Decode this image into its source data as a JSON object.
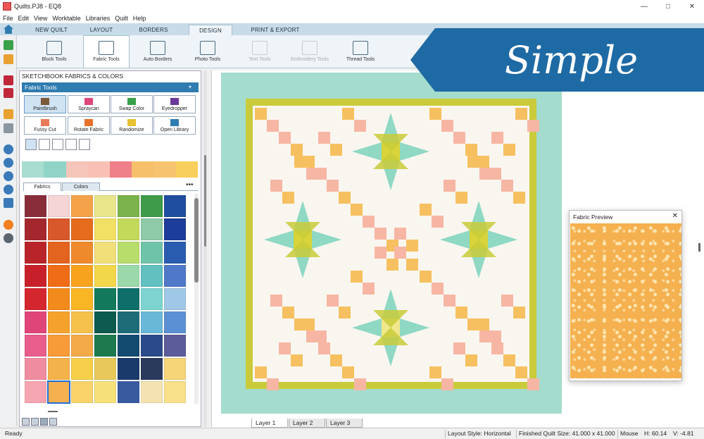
{
  "window": {
    "title": "Quilts.PJ8 - EQ8",
    "min": "—",
    "max": "□",
    "close": "✕"
  },
  "menu": [
    "File",
    "Edit",
    "View",
    "Worktable",
    "Libraries",
    "Quilt",
    "Help"
  ],
  "tabs": [
    "NEW QUILT",
    "LAYOUT",
    "BORDERS",
    "DESIGN",
    "PRINT & EXPORT"
  ],
  "active_tab": "DESIGN",
  "ribbon": [
    {
      "label": "Block Tools",
      "state": "normal"
    },
    {
      "label": "Fabric Tools",
      "state": "active"
    },
    {
      "label": "Auto Borders",
      "state": "normal"
    },
    {
      "label": "Photo Tools",
      "state": "normal"
    },
    {
      "label": "Text Tools",
      "state": "disabled"
    },
    {
      "label": "Embroidery Tools",
      "state": "disabled"
    },
    {
      "label": "Thread Tools",
      "state": "normal"
    }
  ],
  "banner": {
    "text": "Simple",
    "color": "#1e6aa5"
  },
  "panel": {
    "header": "SKETCHBOOK FABRICS & COLORS",
    "section_title": "Fabric Tools",
    "tools": [
      "Paintbrush",
      "Spraycan",
      "Swap Color",
      "Eyedropper",
      "Fussy Cut",
      "Rotate Fabric",
      "Randomize",
      "Open Library"
    ],
    "subtabs": [
      "Fabrics",
      "Colors"
    ],
    "more": "•••"
  },
  "strip_colors": [
    "#a8ddd0",
    "#8fd4c6",
    "#f4c5b8",
    "#f9c1b6",
    "#ef7f88",
    "#f6c06a",
    "#f6c46e",
    "#f8cf5c"
  ],
  "fabric_colors": [
    "#8a2d3b",
    "#f5d5d5",
    "#f5a34a",
    "#e8e58a",
    "#7bb34a",
    "#3e9b4a",
    "#1f4ea0",
    "#a5272e",
    "#d8582c",
    "#e46c1c",
    "#f2e064",
    "#c2d95a",
    "#8ec9a8",
    "#1d3d9a",
    "#b9242a",
    "#e3641e",
    "#ee8a2c",
    "#f1df7a",
    "#b8dd6a",
    "#6fc3a8",
    "#2a5cb0",
    "#c8202a",
    "#ef6d16",
    "#f7a31e",
    "#f3d74a",
    "#9bd8aa",
    "#62c0c0",
    "#4f79c8",
    "#d4262e",
    "#f28a1c",
    "#f8b624",
    "#127a5a",
    "#0d6e6a",
    "#7cd3d0",
    "#9fc7e6",
    "#e0457a",
    "#f5a22c",
    "#f5c14a",
    "#0d5a4e",
    "#1e6c78",
    "#6ab8d8",
    "#5c90d4",
    "#e85d8c",
    "#f79a38",
    "#f3a948",
    "#1c7a4e",
    "#134a70",
    "#2a4a8a",
    "#5c5c9a",
    "#f08ca0",
    "#f4b24a",
    "#f7cf4a",
    "#e8c85a",
    "#1a3a6c",
    "#2a3a5c",
    "#f6d478",
    "#f5a6b0",
    "#f5b04f",
    "#f9d36a",
    "#f6e07a",
    "#3a5aa0",
    "#f2e3b0",
    "#f9e08a"
  ],
  "selected_fabric_index": 57,
  "layers": [
    "Layer 1",
    "Layer 2",
    "Layer 3"
  ],
  "preview": {
    "title": "Fabric Preview",
    "close": "✕"
  },
  "status": {
    "ready": "Ready",
    "layout": "Layout Style: Horizontal",
    "size": "Finished Quilt Size: 41.000 x 41.000 (i",
    "mouse": "Mouse",
    "h": "H:  60.14",
    "v": "V:   -4.81"
  }
}
